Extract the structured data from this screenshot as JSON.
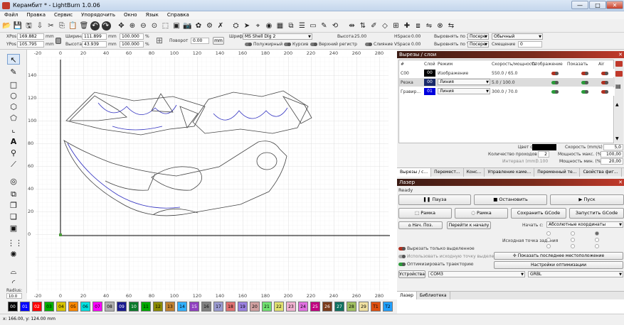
{
  "window": {
    "title": "Керамбит * - LightBurn 1.0.06",
    "min": "—",
    "max": "□",
    "close": "✕"
  },
  "menu": [
    "Файл",
    "Правка",
    "Сервис",
    "Упорядочить",
    "Окно",
    "Язык",
    "Справка"
  ],
  "toolbar": {
    "icons": [
      "open-icon",
      "save-icon",
      "save-as-icon",
      "import-icon",
      "cut-icon",
      "copy-icon",
      "paste-icon",
      "delete-icon",
      "undo-icon",
      "redo-icon",
      "move-icon",
      "zoom-in-icon",
      "zoom-out-icon",
      "zoom-fit-icon",
      "zoom-page-icon",
      "frame-icon",
      "camera-icon",
      "trace-icon",
      "settings-icon",
      "tools-icon",
      "machine-icon",
      "send-icon",
      "target-icon",
      "lock-icon",
      "grid-icon",
      "nest-icon",
      "align-icon",
      "paper-icon",
      "pen-icon",
      "rotate-icon",
      "dist-icon",
      "sort-icon",
      "brush-icon",
      "node-icon",
      "center-icon",
      "cross-icon",
      "weld-icon",
      "flip-icon",
      "xor-icon",
      "mirror-icon"
    ]
  },
  "props": {
    "xpos_label": "XPos",
    "xpos": "169.882",
    "ypos_label": "YPos",
    "ypos": "105.795",
    "mm": "mm",
    "width_label": "Ширина",
    "width": "111.899",
    "height_label": "Высота",
    "height": "43.939",
    "pct_w": "100.000",
    "pct_h": "100.000",
    "pct": "%",
    "rotate_label": "Поворот",
    "rotate": "0.00",
    "mm_btn": "mm",
    "font_label": "Шрифт",
    "font": "MS Shell Dlg 2",
    "fheight_label": "Высота",
    "fheight": "25.00",
    "bold": "Полужирный",
    "italic": "Курсив",
    "upper": "Верхний регистр",
    "weld": "Слияние",
    "hspace_label": "HSpace",
    "hspace": "0.00",
    "vspace_label": "VSpace",
    "vspace": "0.00",
    "alignx_label": "Выровнять по X",
    "alignx": "Посере",
    "aligny_label": "Выровнять по Y",
    "aligny": "Посере",
    "style": "Обычный",
    "offset_label": "Смещение",
    "offset": "0"
  },
  "ruler": {
    "top": [
      "-20",
      "0",
      "20",
      "40",
      "60",
      "80",
      "100",
      "120",
      "140",
      "160",
      "180",
      "200",
      "220",
      "240",
      "260",
      "280"
    ],
    "left": [
      "140",
      "120",
      "100",
      "80",
      "60",
      "40",
      "20",
      "0"
    ],
    "bottom": [
      "-20",
      "0",
      "20",
      "40",
      "60",
      "80",
      "100",
      "120",
      "140",
      "160",
      "180",
      "200",
      "220",
      "240",
      "260",
      "280"
    ]
  },
  "radius_label": "Radius:",
  "radius": "10.0",
  "palette": [
    {
      "n": "00",
      "c": "#000000",
      "t": "#fff"
    },
    {
      "n": "01",
      "c": "#0000ff",
      "t": "#fff"
    },
    {
      "n": "02",
      "c": "#ff0000",
      "t": "#fff"
    },
    {
      "n": "03",
      "c": "#00b000",
      "t": "#000"
    },
    {
      "n": "04",
      "c": "#d6c200",
      "t": "#000"
    },
    {
      "n": "05",
      "c": "#ff8800",
      "t": "#000"
    },
    {
      "n": "06",
      "c": "#00e0e0",
      "t": "#000"
    },
    {
      "n": "07",
      "c": "#ff00ff",
      "t": "#000"
    },
    {
      "n": "08",
      "c": "#b0b0b0",
      "t": "#000"
    },
    {
      "n": "09",
      "c": "#1a1a90",
      "t": "#fff"
    },
    {
      "n": "10",
      "c": "#0a7a2a",
      "t": "#fff"
    },
    {
      "n": "11",
      "c": "#00aa00",
      "t": "#000"
    },
    {
      "n": "12",
      "c": "#8a8a00",
      "t": "#000"
    },
    {
      "n": "13",
      "c": "#c08030",
      "t": "#000"
    },
    {
      "n": "14",
      "c": "#30b0ff",
      "t": "#000"
    },
    {
      "n": "15",
      "c": "#9040c0",
      "t": "#fff"
    },
    {
      "n": "16",
      "c": "#808080",
      "t": "#000"
    },
    {
      "n": "17",
      "c": "#9a9ad0",
      "t": "#000"
    },
    {
      "n": "18",
      "c": "#e07070",
      "t": "#000"
    },
    {
      "n": "19",
      "c": "#9a80e0",
      "t": "#000"
    },
    {
      "n": "20",
      "c": "#d0a0a0",
      "t": "#000"
    },
    {
      "n": "21",
      "c": "#70e070",
      "t": "#000"
    },
    {
      "n": "22",
      "c": "#e0e070",
      "t": "#000"
    },
    {
      "n": "23",
      "c": "#f0b0d0",
      "t": "#000"
    },
    {
      "n": "24",
      "c": "#e070e0",
      "t": "#000"
    },
    {
      "n": "25",
      "c": "#c00080",
      "t": "#fff"
    },
    {
      "n": "26",
      "c": "#7a3a1a",
      "t": "#fff"
    },
    {
      "n": "27",
      "c": "#107060",
      "t": "#fff"
    },
    {
      "n": "28",
      "c": "#a0c060",
      "t": "#000"
    },
    {
      "n": "29",
      "c": "#f0e0a0",
      "t": "#000"
    },
    {
      "n": "T1",
      "c": "#e05010",
      "t": "#000"
    },
    {
      "n": "T2",
      "c": "#20a0ff",
      "t": "#000"
    }
  ],
  "status": "x: 166.00, y: 124.00 mm",
  "cuts": {
    "title": "Вырезы / слои",
    "cols": [
      "#",
      "Слой",
      "Режим",
      "Скорость/мощность",
      "Отображение",
      "Показать",
      "Air"
    ],
    "rows": [
      {
        "num": "C00",
        "layer": "00",
        "layer_color": "#000000",
        "mode": "Изображение",
        "speed": "550.0 / 65.0",
        "display_on": false
      },
      {
        "num": "Резка",
        "layer": "00",
        "layer_color": "#1a2a6a",
        "mode": "Линия",
        "speed": "5.0 / 100.0",
        "display_on": true
      },
      {
        "num": "Гравир...",
        "layer": "01",
        "layer_color": "#0000dd",
        "mode": "Линия",
        "speed": "300.0 / 70.0",
        "display_on": true
      }
    ],
    "color_label": "Цвет слоя",
    "speed_label": "Скорость (mm/s)",
    "speed": "5,0",
    "passes_label": "Количество проходов",
    "passes": "2",
    "maxp_label": "Мощность макс. (%)",
    "maxp": "100,00",
    "interval_label": "Интервал (mm)",
    "interval": "0.100",
    "minp_label": "Мощность мин. (%)",
    "minp": "20,00",
    "tabs": [
      "Вырезы / с...",
      "Перемест...",
      "Конс...",
      "Управление каме...",
      "Переменный те...",
      "Свойства фиг..."
    ]
  },
  "laser": {
    "title": "Лазер",
    "state": "Ready",
    "pause": "Пауза",
    "stop": "Остановить",
    "start": "Пуск",
    "frame1": "Рамка",
    "frame2": "Рамка",
    "save_gcode": "Сохранить GCode",
    "run_gcode": "Запустить GCode",
    "home": "Нач. Поз.",
    "goto": "Перейти к началу",
    "start_from_label": "Начать с:",
    "start_from": "Абсолютные координаты",
    "job_origin": "Исходная точка задания",
    "cut_selected": "Вырезать только выделенное",
    "use_origin": "Использовать исходную точку выделения",
    "show_last": "Показать последнее местоположение",
    "optimize": "Оптимизировать траекторию",
    "opt_settings": "Настройки оптимизации",
    "devices": "Устройства",
    "port": "COM3",
    "controller": "GRBL",
    "tabs": [
      "Лазер",
      "Библиотека"
    ]
  }
}
